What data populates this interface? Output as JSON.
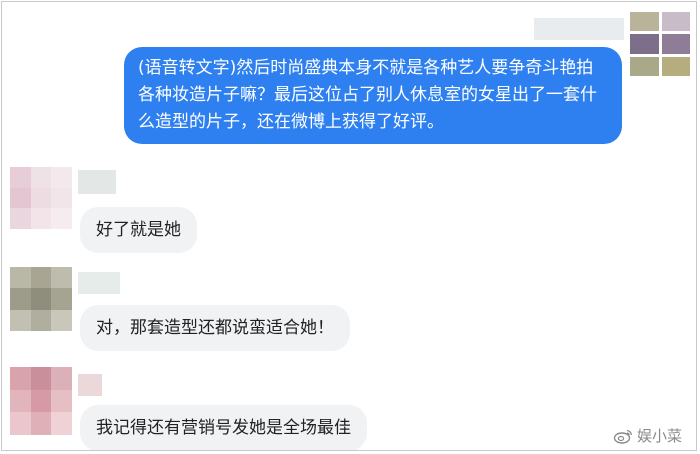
{
  "chat": {
    "outgoing": {
      "text": "(语音转文字)然后时尚盛典本身不就是各种艺人要争奇斗艳拍各种妆造片子嘛？最后这位占了别人休息室的女星出了一套什么造型的片子，还在微博上获得了好评。"
    },
    "incoming": [
      {
        "text": "好了就是她"
      },
      {
        "text": "对，那套造型还都说蛮适合她！"
      },
      {
        "text": "我记得还有营销号发她是全场最佳"
      }
    ]
  },
  "watermark": {
    "text": "娱小菜",
    "icon": "weibo-logo-icon"
  },
  "colors": {
    "outgoing_bubble": "#2e80f0",
    "incoming_bubble": "#f1f2f4"
  }
}
